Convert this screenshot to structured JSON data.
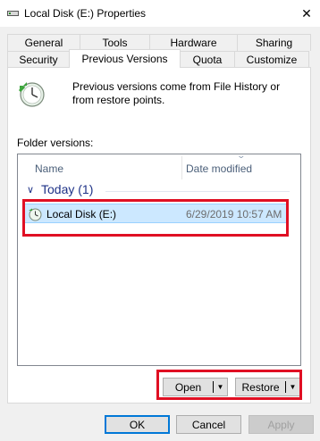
{
  "window": {
    "title": "Local Disk (E:) Properties",
    "close_glyph": "✕"
  },
  "tabs": {
    "row1": [
      {
        "label": "General"
      },
      {
        "label": "Tools"
      },
      {
        "label": "Hardware"
      },
      {
        "label": "Sharing"
      }
    ],
    "row2": [
      {
        "label": "Security"
      },
      {
        "label": "Previous Versions",
        "active": true
      },
      {
        "label": "Quota"
      },
      {
        "label": "Customize"
      }
    ]
  },
  "panel": {
    "info_text": "Previous versions come from File History or from restore points.",
    "folder_versions_label": "Folder versions:",
    "columns": {
      "name": "Name",
      "date": "Date modified"
    },
    "group": {
      "label": "Today (1)"
    },
    "items": [
      {
        "name": "Local Disk (E:)",
        "date": "6/29/2019 10:57 AM",
        "selected": true
      }
    ],
    "buttons": {
      "open": "Open",
      "restore": "Restore"
    }
  },
  "footer": {
    "ok": "OK",
    "cancel": "Cancel",
    "apply": "Apply"
  },
  "colors": {
    "highlight": "#e00f23",
    "selection": "#cce8ff",
    "group_text": "#1e3287"
  }
}
